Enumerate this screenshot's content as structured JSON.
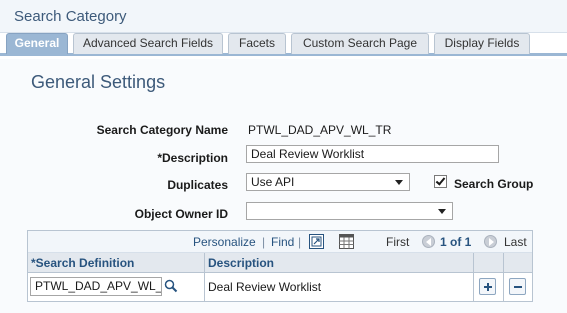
{
  "page": {
    "title": "Search Category"
  },
  "tabs": [
    {
      "label": "General",
      "active": true
    },
    {
      "label": "Advanced Search Fields",
      "active": false
    },
    {
      "label": "Facets",
      "active": false
    },
    {
      "label": "Custom Search Page",
      "active": false
    },
    {
      "label": "Display Fields",
      "active": false
    }
  ],
  "section": {
    "title": "General Settings"
  },
  "form": {
    "search_category_name": {
      "label": "Search Category Name",
      "value": "PTWL_DAD_APV_WL_TR"
    },
    "description": {
      "label": "*Description",
      "value": "Deal Review Worklist"
    },
    "duplicates": {
      "label": "Duplicates",
      "value": "Use API"
    },
    "search_group": {
      "label": "Search Group",
      "checked": true
    },
    "object_owner_id": {
      "label": "Object Owner ID",
      "value": ""
    }
  },
  "grid": {
    "toolbar": {
      "personalize": "Personalize",
      "separator": "|",
      "find": "Find",
      "first": "First",
      "range": "1 of 1",
      "last": "Last"
    },
    "columns": [
      "*Search Definition",
      "Description"
    ],
    "rows": [
      {
        "search_definition": "PTWL_DAD_APV_WL_T",
        "description": "Deal Review Worklist"
      }
    ]
  },
  "colors": {
    "title": "#3d5a7a",
    "link": "#27537f",
    "tab_active": "#9bb7d4",
    "header_bg": "#e3e8ee"
  },
  "icons": [
    "lookup-icon",
    "zoom-icon",
    "download-icon",
    "previous-icon",
    "next-icon",
    "add-row-icon",
    "delete-row-icon"
  ]
}
